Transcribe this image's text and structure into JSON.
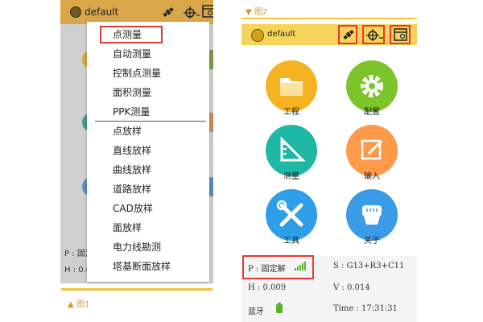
{
  "left_screen": {
    "app_title": "default",
    "bg_fragments": {
      "p_label": "P : 固定",
      "h_label": "H : 0.0"
    },
    "menu_items": [
      "点测量",
      "自动测量",
      "控制点测量",
      "面积测量",
      "PPK测量",
      "点放样",
      "直线放样",
      "曲线放样",
      "道路放样",
      "CAD放样",
      "面放样",
      "电力线勘测",
      "塔基断面放样"
    ],
    "caption": "▲  图1"
  },
  "right_screen": {
    "caption": "▼  图2",
    "app_title": "default",
    "tiles": [
      {
        "label": "工程",
        "color": "#f5b321",
        "icon": "folder-icon"
      },
      {
        "label": "配置",
        "color": "#7dc32a",
        "icon": "gear-icon"
      },
      {
        "label": "测量",
        "color": "#1fb8a4",
        "icon": "ruler-icon"
      },
      {
        "label": "输入",
        "color": "#ff9a4a",
        "icon": "edit-icon"
      },
      {
        "label": "工具",
        "color": "#2f9ee8",
        "icon": "tools-icon"
      },
      {
        "label": "关于",
        "color": "#3a9be6",
        "icon": "device-icon"
      }
    ],
    "status": {
      "p": "P : 固定解",
      "s": "S : G13+R3+C11",
      "h": "H : 0.009",
      "v": "V : 0.014",
      "bt": "蓝牙",
      "time": "Time :  17:31:31"
    }
  },
  "colors": {
    "accent_orange": "#e09a1e",
    "highlight_red": "#e53935",
    "signal_green": "#5bb52b"
  }
}
